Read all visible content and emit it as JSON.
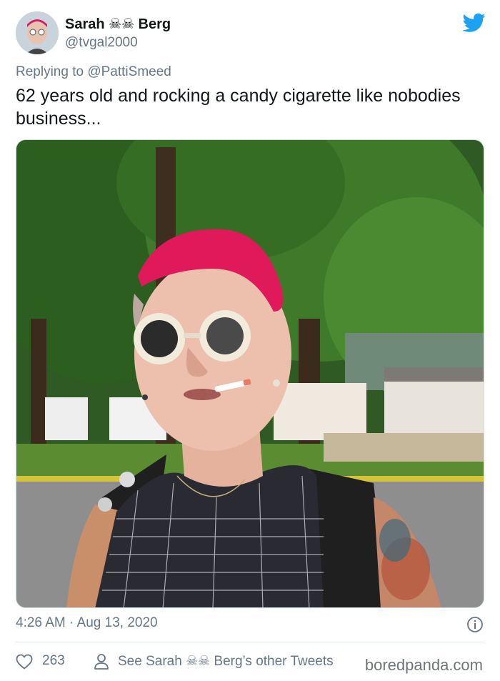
{
  "tweet": {
    "display_name": "Sarah ☠☠ Berg",
    "handle": "@tvgal2000",
    "replying_prefix": "Replying to",
    "replying_to": "@PattiSmeed",
    "text": "62 years old and rocking a candy cigarette like nobodies business...",
    "timestamp": "4:26 AM · Aug 13, 2020",
    "like_count": "263",
    "other_tweets_label": "See Sarah ☠☠ Berg’s other Tweets"
  },
  "watermark": "boredpanda.com",
  "colors": {
    "twitter_blue": "#1da1f2",
    "muted_text": "#657786",
    "primary_text": "#14171a",
    "hair_pink": "#e0195a"
  },
  "icons": {
    "brand": "twitter-bird-icon",
    "info": "info-icon",
    "like": "heart-outline-icon",
    "profile": "person-outline-icon"
  }
}
